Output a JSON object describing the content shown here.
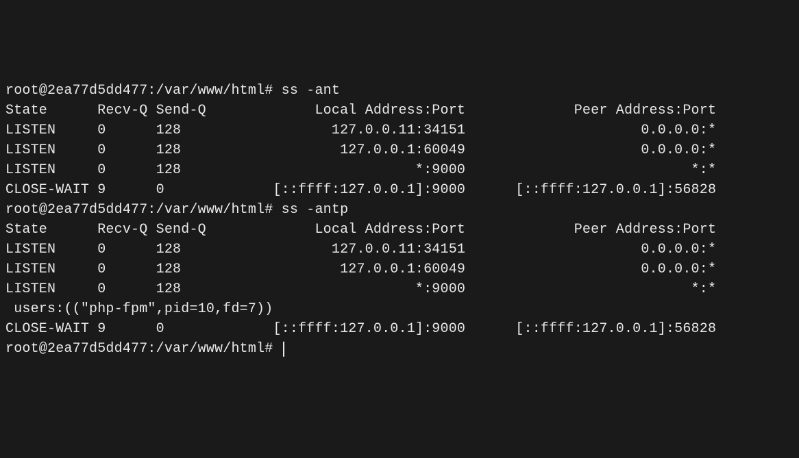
{
  "prompt": {
    "user": "root",
    "host": "2ea77d5dd477",
    "path": "/var/www/html",
    "symbol": "#"
  },
  "commands": {
    "ss_ant": "ss -ant",
    "ss_antp": "ss -antp"
  },
  "headers": {
    "state": "State",
    "recvq": "Recv-Q",
    "sendq": "Send-Q",
    "local": "Local Address:Port",
    "peer": "Peer Address:Port"
  },
  "ss_ant_rows": [
    {
      "state": "LISTEN",
      "recvq": "0",
      "sendq": "128",
      "local": "127.0.0.11:34151",
      "peer": "0.0.0.0:*"
    },
    {
      "state": "LISTEN",
      "recvq": "0",
      "sendq": "128",
      "local": "127.0.0.1:60049",
      "peer": "0.0.0.0:*"
    },
    {
      "state": "LISTEN",
      "recvq": "0",
      "sendq": "128",
      "local": "*:9000",
      "peer": "*:*"
    },
    {
      "state": "CLOSE-WAIT",
      "recvq": "9",
      "sendq": "0",
      "local": "[::ffff:127.0.0.1]:9000",
      "peer": "[::ffff:127.0.0.1]:56828"
    }
  ],
  "ss_antp_rows": [
    {
      "state": "LISTEN",
      "recvq": "0",
      "sendq": "128",
      "local": "127.0.0.11:34151",
      "peer": "0.0.0.0:*",
      "extra": ""
    },
    {
      "state": "LISTEN",
      "recvq": "0",
      "sendq": "128",
      "local": "127.0.0.1:60049",
      "peer": "0.0.0.0:*",
      "extra": ""
    },
    {
      "state": "LISTEN",
      "recvq": "0",
      "sendq": "128",
      "local": "*:9000",
      "peer": "*:*",
      "extra": " users:((\"php-fpm\",pid=10,fd=7))"
    },
    {
      "state": "CLOSE-WAIT",
      "recvq": "9",
      "sendq": "0",
      "local": "[::ffff:127.0.0.1]:9000",
      "peer": "[::ffff:127.0.0.1]:56828",
      "extra": ""
    }
  ]
}
